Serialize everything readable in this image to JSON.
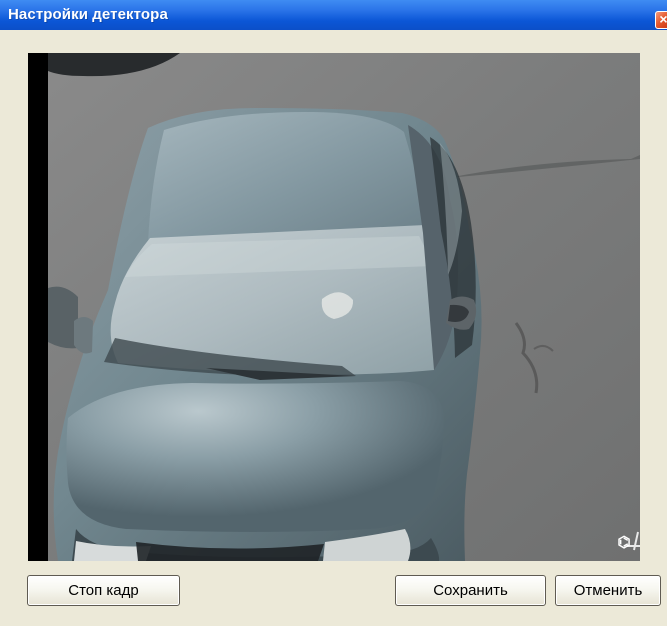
{
  "window": {
    "title": "Настройки детектора",
    "close_label": "×"
  },
  "video": {
    "preview_description": ""
  },
  "icons": {
    "close": "close-icon",
    "logo": "camera-logo-icon"
  },
  "buttons": {
    "stop_frame": "Стоп кадр",
    "save": "Сохранить",
    "cancel": "Отменить"
  },
  "colors": {
    "title_bar": "#0b56d6",
    "dialog_background": "#ece9d8",
    "close_button": "#e5582d",
    "video_border": "#000000"
  }
}
